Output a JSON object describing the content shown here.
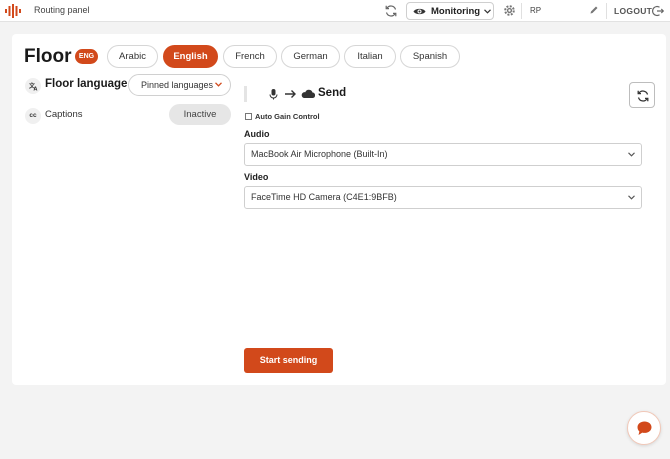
{
  "topbar": {
    "title": "Routing panel",
    "monitoring_label": "Monitoring",
    "user_initials": "RP",
    "logout_label": "LOGOUT",
    "icons": {
      "logo": "audio-bars-icon",
      "sync": "sync-icon",
      "monitor": "eye-icon",
      "settings": "gear-icon",
      "edit": "pencil-icon",
      "logout": "logout-icon"
    }
  },
  "floor": {
    "title": "Floor",
    "badge": "ENG"
  },
  "languages": [
    {
      "label": "Arabic",
      "active": false
    },
    {
      "label": "English",
      "active": true
    },
    {
      "label": "French",
      "active": false
    },
    {
      "label": "German",
      "active": false
    },
    {
      "label": "Italian",
      "active": false
    },
    {
      "label": "Spanish",
      "active": false
    }
  ],
  "left": {
    "floor_language_label": "Floor language",
    "pinned_dropdown": "Pinned languages",
    "captions_icon_text": "cc",
    "captions_label": "Captions",
    "captions_status": "Inactive"
  },
  "send": {
    "label": "Send",
    "auto_gain_label": "Auto Gain Control",
    "auto_gain_checked": false,
    "audio_label": "Audio",
    "audio_value": "MacBook Air Microphone (Built-In)",
    "video_label": "Video",
    "video_value": "FaceTime HD Camera (C4E1:9BFB)",
    "start_label": "Start sending"
  },
  "colors": {
    "accent": "#d2491b",
    "background": "#f3f3f3",
    "card": "#ffffff"
  }
}
